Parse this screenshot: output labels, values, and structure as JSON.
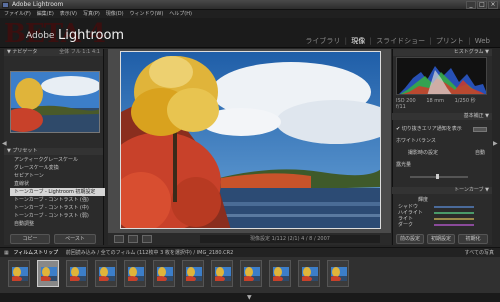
{
  "window": {
    "title": "Adobe Lightroom",
    "min": "_",
    "max": "□",
    "close": "×"
  },
  "menu": [
    "ファイル(F)",
    "編集(E)",
    "表示(V)",
    "写真(P)",
    "現像(D)",
    "ウィンドウ(W)",
    "ヘルプ(H)"
  ],
  "branding": {
    "watermark": "BETA 4",
    "adobe": "Adobe",
    "product": "Lightroom"
  },
  "modules": {
    "library": "ライブラリ",
    "develop": "現像",
    "slideshow": "スライドショー",
    "print": "プリント",
    "web": "Web",
    "sep": "|"
  },
  "left": {
    "navigator_header": "▼ ナビゲータ",
    "zoom_options": "全体  フル  1:1  4:1",
    "presets_header": "▼ プリセット",
    "presets": [
      "アンティークグレースケール",
      "グレースケール変換",
      "セピアトーン",
      "直線状",
      "トーンカーブ - Lightroom 初期設定",
      "トーンカーブ - コントラスト (強)",
      "トーンカーブ - コントラスト (中)",
      "トーンカーブ - コントラスト (弱)",
      "自動調整"
    ],
    "selected_preset_index": 4,
    "copy_button": "コピー",
    "paste_button": "ペースト"
  },
  "center": {
    "status": "現像設定 1/112 (2/1) 4 / 8 / 2007"
  },
  "right": {
    "histogram_header": "ヒストグラム ▼",
    "exif": [
      "ISO 200",
      "18 mm",
      "1/250 秒",
      "f/11"
    ],
    "basic_header": "基本補正 ▼",
    "show_clipping": "切り抜きエリア通知を表示",
    "wb_label": "ホワイトバランス",
    "auto_label": "自動",
    "wb_value": "撮影時の設定",
    "exposure_label": "露光量",
    "tone_header": "トーンカーブ ▼",
    "hsl_label": "輝度",
    "sliders": [
      "シャドウ",
      "ハイライト",
      "ライト",
      "ダーク"
    ],
    "prev_button": "前の設定",
    "reset_button": "初期設定",
    "reset_all_button": "初期化"
  },
  "filmbar": {
    "label": "フィルムストリップ",
    "info": "前回読み込み / 全てのフィルム (112枚中 3 枚を選択中) / IMG_2180.CR2",
    "filter": "すべての写真"
  },
  "filmstrip": {
    "count": 12,
    "active_index": 1
  },
  "colors": {
    "accent": "#d8b24a",
    "panel": "#2b2b2b",
    "sky": "#3c7ec9",
    "foliage_red": "#c8412a",
    "foliage_yellow": "#e0b43a"
  }
}
